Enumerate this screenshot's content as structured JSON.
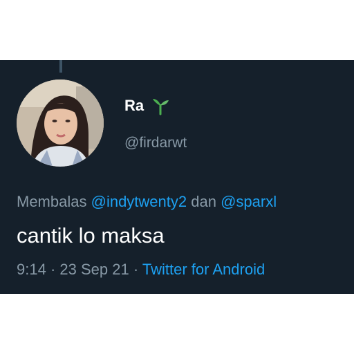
{
  "tweet": {
    "display_name": "Ra",
    "handle": "@firdarwt",
    "reply": {
      "prefix": "Membalas",
      "mention_1": "@indytwenty2",
      "connector": "dan",
      "mention_2": "@sparxl"
    },
    "text": "cantik lo maksa",
    "time": "9:14",
    "separator": "·",
    "date": "23 Sep 21",
    "source": "Twitter for Android"
  },
  "icons": {
    "name_emoji": "seedling-icon",
    "avatar": "profile-photo"
  },
  "colors": {
    "background": "#15202b",
    "text_primary": "#ffffff",
    "text_secondary": "#8899a6",
    "accent": "#1da1f2",
    "seedling": "#4caf50"
  }
}
